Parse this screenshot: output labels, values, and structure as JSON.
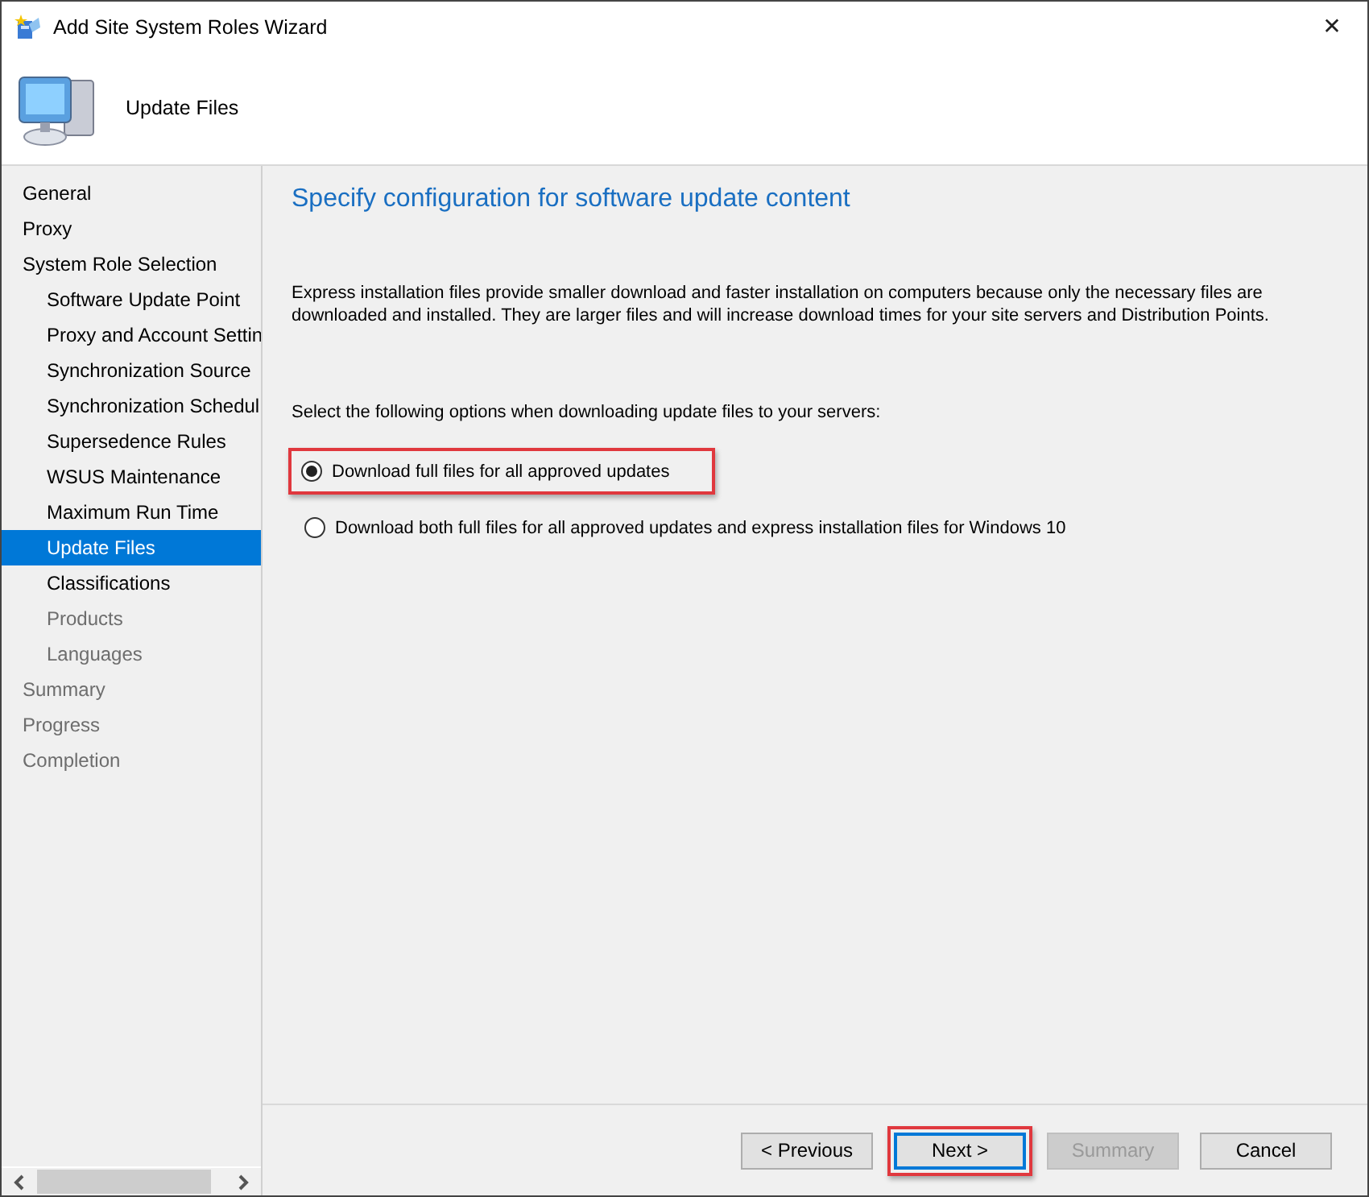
{
  "window": {
    "title": "Add Site System Roles Wizard",
    "close": "✕"
  },
  "header": {
    "title": "Update Files"
  },
  "sidebar": {
    "items": [
      {
        "label": "General",
        "kind": "top",
        "selected": false,
        "disabled": false
      },
      {
        "label": "Proxy",
        "kind": "top",
        "selected": false,
        "disabled": false
      },
      {
        "label": "System Role Selection",
        "kind": "top",
        "selected": false,
        "disabled": false
      },
      {
        "label": "Software Update Point",
        "kind": "sub",
        "selected": false,
        "disabled": false
      },
      {
        "label": "Proxy and Account Settin",
        "kind": "sub",
        "selected": false,
        "disabled": false
      },
      {
        "label": "Synchronization Source",
        "kind": "sub",
        "selected": false,
        "disabled": false
      },
      {
        "label": "Synchronization Schedul",
        "kind": "sub",
        "selected": false,
        "disabled": false
      },
      {
        "label": "Supersedence Rules",
        "kind": "sub",
        "selected": false,
        "disabled": false
      },
      {
        "label": "WSUS Maintenance",
        "kind": "sub",
        "selected": false,
        "disabled": false
      },
      {
        "label": "Maximum Run Time",
        "kind": "sub",
        "selected": false,
        "disabled": false
      },
      {
        "label": "Update Files",
        "kind": "sub",
        "selected": true,
        "disabled": false
      },
      {
        "label": "Classifications",
        "kind": "sub",
        "selected": false,
        "disabled": false
      },
      {
        "label": "Products",
        "kind": "sub",
        "selected": false,
        "disabled": true
      },
      {
        "label": "Languages",
        "kind": "sub",
        "selected": false,
        "disabled": true
      },
      {
        "label": "Summary",
        "kind": "top",
        "selected": false,
        "disabled": true
      },
      {
        "label": "Progress",
        "kind": "top",
        "selected": false,
        "disabled": true
      },
      {
        "label": "Completion",
        "kind": "top",
        "selected": false,
        "disabled": true
      }
    ]
  },
  "content": {
    "heading": "Specify configuration for software update content",
    "description": "Express installation files provide smaller download and faster installation on computers because only the necessary files are downloaded and installed.  They are larger files and will increase download times for your site servers and Distribution Points.",
    "prompt": "Select the following options when downloading update files to your servers:",
    "options": [
      {
        "label": "Download full files for all approved updates",
        "selected": true,
        "highlighted": true
      },
      {
        "label": "Download both full files for all approved updates and express installation files for Windows 10",
        "selected": false,
        "highlighted": false
      }
    ]
  },
  "buttons": [
    {
      "label": "< Previous",
      "disabled": false,
      "focused": false,
      "highlighted": false
    },
    {
      "label": "Next >",
      "disabled": false,
      "focused": true,
      "highlighted": true
    },
    {
      "label": "Summary",
      "disabled": true,
      "focused": false,
      "highlighted": false
    },
    {
      "label": "Cancel",
      "disabled": false,
      "focused": false,
      "highlighted": false
    }
  ]
}
